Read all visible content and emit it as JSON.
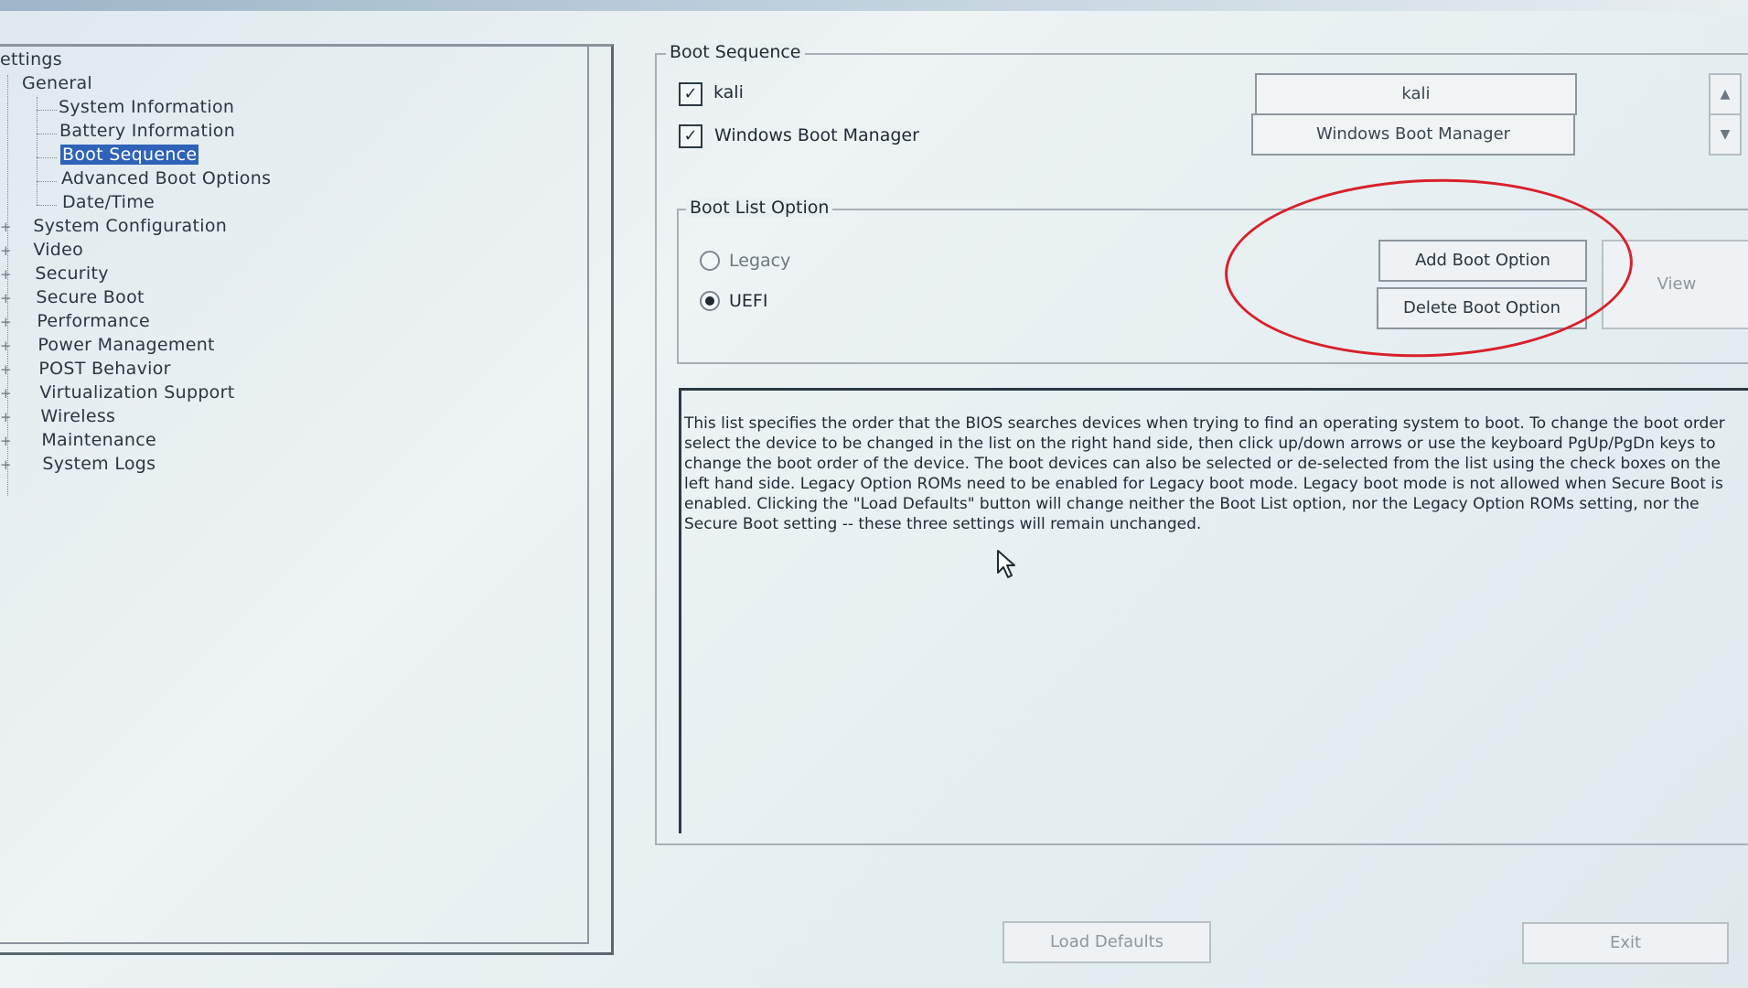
{
  "tree": {
    "root": "ettings",
    "items": [
      {
        "label": "General",
        "expanded": true
      },
      {
        "label": "System Information"
      },
      {
        "label": "Battery Information"
      },
      {
        "label": "Boot Sequence",
        "selected": true
      },
      {
        "label": "Advanced Boot Options"
      },
      {
        "label": "Date/Time"
      },
      {
        "label": "System Configuration"
      },
      {
        "label": "Video"
      },
      {
        "label": "Security"
      },
      {
        "label": "Secure Boot"
      },
      {
        "label": "Performance"
      },
      {
        "label": "Power Management"
      },
      {
        "label": "POST Behavior"
      },
      {
        "label": "Virtualization Support"
      },
      {
        "label": "Wireless"
      },
      {
        "label": "Maintenance"
      },
      {
        "label": "System Logs"
      }
    ]
  },
  "boot_sequence": {
    "title": "Boot Sequence",
    "entries": [
      {
        "label": "kali",
        "checked": true
      },
      {
        "label": "Windows Boot Manager",
        "checked": true
      }
    ],
    "order_list": [
      "kali",
      "Windows Boot Manager"
    ],
    "up_icon": "arrow-up-icon",
    "down_icon": "arrow-down-icon"
  },
  "boot_list_option": {
    "title": "Boot List Option",
    "legacy_label": "Legacy",
    "uefi_label": "UEFI",
    "selected": "UEFI"
  },
  "buttons": {
    "add_boot_option": "Add Boot Option",
    "delete_boot_option": "Delete Boot Option",
    "view": "View",
    "load_defaults": "Load Defaults",
    "exit": "Exit"
  },
  "description": "This list specifies the order that the BIOS searches devices when trying to find an operating system to boot. To change the boot order select the device to be changed in the list on the right hand side, then click up/down arrows or use the keyboard PgUp/PgDn keys to change the boot order of the device. The boot devices can also be selected or de-selected from the list using the check boxes on the left hand side. Legacy Option ROMs need to be enabled for Legacy boot mode. Legacy boot mode is not allowed when Secure Boot is enabled. Clicking the \"Load Defaults\" button will change neither the Boot List option, nor the Legacy Option ROMs setting, nor the Secure Boot setting -- these three settings will remain unchanged.",
  "colors": {
    "selection": "#2f63b8",
    "annotation_circle": "#d8202a"
  }
}
